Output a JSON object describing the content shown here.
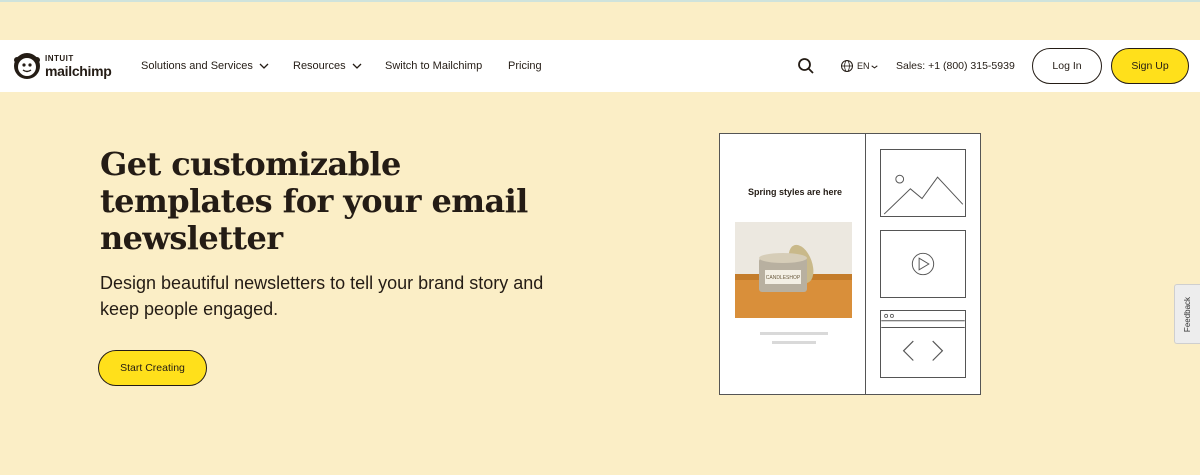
{
  "brand": {
    "top": "INTUIT",
    "name": "mailchimp"
  },
  "nav": {
    "items": [
      {
        "label": "Solutions and Services",
        "has_dropdown": true
      },
      {
        "label": "Resources",
        "has_dropdown": true
      },
      {
        "label": "Switch to Mailchimp",
        "has_dropdown": false
      },
      {
        "label": "Pricing",
        "has_dropdown": false
      }
    ],
    "search_icon": "search-icon",
    "language": "EN",
    "language_icon": "globe-icon",
    "sales": "Sales: +1 (800) 315-5939",
    "login": "Log In",
    "signup": "Sign Up"
  },
  "hero": {
    "title": "Get customizable templates for your email newsletter",
    "subtitle": "Design beautiful newsletters to tell your brand story and keep people engaged.",
    "cta": "Start Creating"
  },
  "illustration": {
    "headline": "Spring styles are here",
    "product_label": "CANDLESHOP",
    "blocks": [
      "image-placeholder-icon",
      "video-placeholder-icon",
      "carousel-placeholder-icon"
    ]
  },
  "feedback_tab": "Feedback",
  "colors": {
    "background": "#fbeec6",
    "accent_yellow": "#ffe01b",
    "text": "#241c15",
    "navbar": "#ffffff"
  }
}
